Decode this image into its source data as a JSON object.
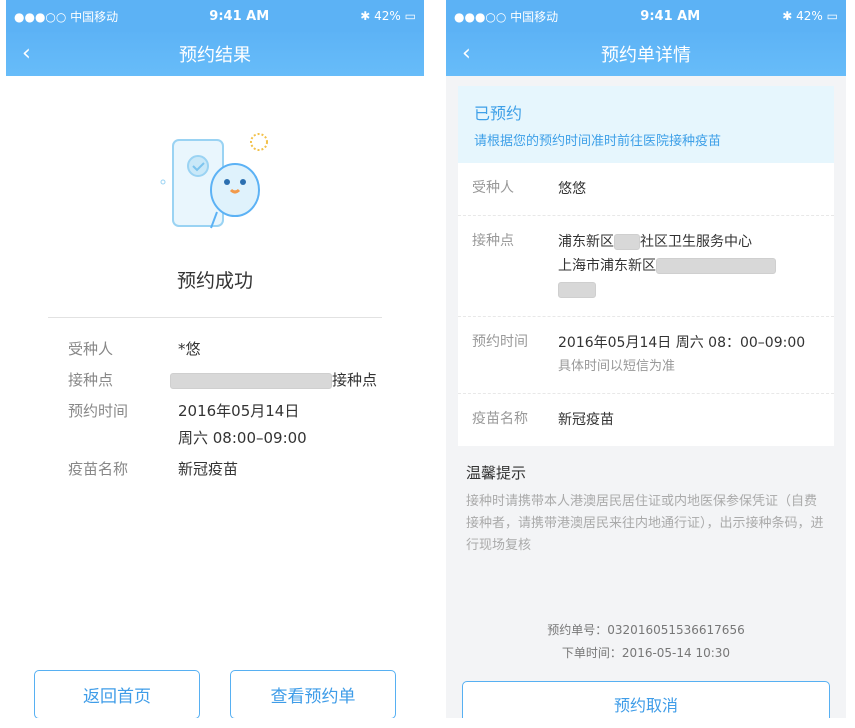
{
  "status_bar": {
    "carrier": "●●●○○ 中国移动",
    "time": "9:41 AM",
    "battery": "42%"
  },
  "left": {
    "nav_title": "预约结果",
    "success_title": "预约成功",
    "rows": {
      "recipient": {
        "label": "受种人",
        "value": "*悠"
      },
      "site": {
        "label": "接种点",
        "value": "接种点"
      },
      "time": {
        "label": "预约时间",
        "value1": "2016年05月14日",
        "value2": "周六 08:00–09:00"
      },
      "vaccine": {
        "label": "疫苗名称",
        "value": "新冠疫苗"
      }
    },
    "btn_home": "返回首页",
    "btn_view": "查看预约单"
  },
  "right": {
    "nav_title": "预约单详情",
    "status_title": "已预约",
    "status_desc": "请根据您的预约时间准时前往医院接种疫苗",
    "rows": {
      "recipient": {
        "label": "受种人",
        "value": "悠悠"
      },
      "site": {
        "label": "接种点",
        "line1_a": "浦东新区",
        "line1_b": "社区卫生服务中心",
        "line2": "上海市浦东新区"
      },
      "time": {
        "label": "预约时间",
        "value": "2016年05月14日 周六 08：00–09:00",
        "sub": "具体时间以短信为准"
      },
      "vaccine": {
        "label": "疫苗名称",
        "value": "新冠疫苗"
      }
    },
    "tips_title": "温馨提示",
    "tips_body": "接种时请携带本人港澳居民居住证或内地医保参保凭证（自费接种者，请携带港澳居民来往内地通行证），出示接种条码，进行现场复核",
    "order_no": "预约单号：032016051536617656",
    "order_time": "下单时间：2016-05-14 10:30",
    "btn_cancel": "预约取消"
  },
  "colors": {
    "accent": "#5cb2f5",
    "accent_text": "#3e9ce8",
    "status_bg": "#e6f6fd"
  }
}
